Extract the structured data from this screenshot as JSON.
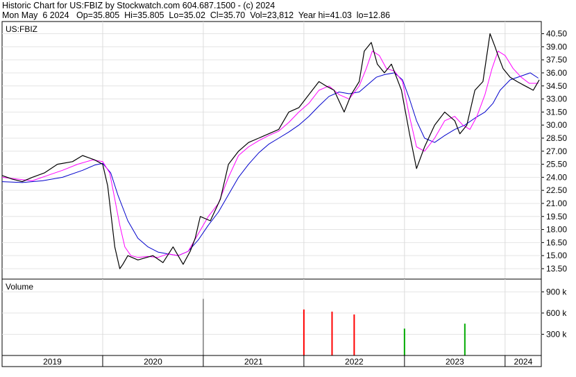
{
  "header": {
    "title": "Historic Chart for US:FBIZ by Stockwatch.com 604.687.1500 - (c) 2024",
    "stats": "Mon May  6 2024   Op=35.805  Hi=35.805  Lo=35.02  Cl=35.70  Vol=23,812  Year hi=41.03  lo=12.86"
  },
  "chart_data": {
    "type": "line",
    "symbol_label": "US:FBIZ",
    "volume_label": "Volume",
    "price_axis": {
      "ticks": [
        "40.50",
        "39.00",
        "37.50",
        "36.00",
        "34.50",
        "33.00",
        "31.50",
        "30.00",
        "28.50",
        "27.00",
        "25.50",
        "24.00",
        "22.50",
        "21.00",
        "19.50",
        "18.00",
        "16.50",
        "15.00",
        "13.50"
      ],
      "ylim": [
        12.3,
        41.9
      ]
    },
    "volume_axis": {
      "ticks": [
        "900 k",
        "600 k",
        "300 k"
      ],
      "ylim": [
        0,
        1080000
      ]
    },
    "years": [
      "2019",
      "2020",
      "2021",
      "2022",
      "2023",
      "2024"
    ],
    "x_range": [
      2019.0,
      2024.36
    ],
    "year_boundaries": [
      2019.0,
      2020.0,
      2021.0,
      2022.0,
      2023.0,
      2024.0
    ],
    "price_series": {
      "name": "",
      "color": "#000000",
      "x": [
        2019.0,
        2019.1,
        2019.2,
        2019.3,
        2019.42,
        2019.55,
        2019.7,
        2019.8,
        2019.92,
        2020.0,
        2020.05,
        2020.12,
        2020.17,
        2020.2,
        2020.25,
        2020.35,
        2020.5,
        2020.6,
        2020.7,
        2020.8,
        2020.87,
        2020.92,
        2020.97,
        2021.07,
        2021.17,
        2021.25,
        2021.35,
        2021.45,
        2021.55,
        2021.65,
        2021.75,
        2021.85,
        2021.95,
        2022.05,
        2022.15,
        2022.22,
        2022.3,
        2022.4,
        2022.47,
        2022.55,
        2022.6,
        2022.67,
        2022.73,
        2022.8,
        2022.87,
        2022.92,
        2022.97,
        2023.05,
        2023.12,
        2023.2,
        2023.3,
        2023.4,
        2023.5,
        2023.55,
        2023.62,
        2023.7,
        2023.78,
        2023.85,
        2023.9,
        2023.93,
        2023.98,
        2024.05,
        2024.12,
        2024.2,
        2024.28,
        2024.34
      ],
      "y": [
        24.2,
        23.8,
        23.5,
        24.0,
        24.5,
        25.5,
        25.8,
        26.5,
        26.0,
        25.5,
        23.0,
        16.0,
        13.5,
        14.0,
        15.0,
        14.5,
        15.0,
        14.2,
        16.0,
        14.0,
        15.5,
        17.0,
        19.5,
        19.0,
        21.5,
        25.5,
        27.0,
        28.0,
        28.5,
        29.0,
        29.5,
        31.5,
        32.0,
        33.5,
        35.0,
        34.5,
        34.0,
        31.5,
        33.5,
        35.0,
        38.5,
        39.5,
        37.0,
        36.0,
        37.0,
        35.5,
        34.0,
        29.0,
        25.0,
        27.5,
        30.0,
        31.5,
        30.5,
        29.0,
        30.0,
        34.0,
        35.0,
        40.5,
        39.0,
        38.0,
        36.5,
        35.5,
        35.0,
        34.5,
        34.0,
        35.2
      ]
    },
    "ma_short": {
      "name": "",
      "color": "#ff00ff",
      "x": [
        2019.0,
        2019.15,
        2019.3,
        2019.45,
        2019.6,
        2019.75,
        2019.9,
        2020.0,
        2020.07,
        2020.12,
        2020.17,
        2020.22,
        2020.28,
        2020.35,
        2020.45,
        2020.55,
        2020.65,
        2020.75,
        2020.85,
        2020.95,
        2021.05,
        2021.15,
        2021.25,
        2021.35,
        2021.45,
        2021.55,
        2021.65,
        2021.75,
        2021.85,
        2021.95,
        2022.05,
        2022.15,
        2022.25,
        2022.35,
        2022.45,
        2022.55,
        2022.62,
        2022.68,
        2022.75,
        2022.82,
        2022.9,
        2022.98,
        2023.05,
        2023.12,
        2023.2,
        2023.3,
        2023.4,
        2023.5,
        2023.58,
        2023.65,
        2023.72,
        2023.8,
        2023.87,
        2023.93,
        2024.0,
        2024.08,
        2024.16,
        2024.24,
        2024.33
      ],
      "y": [
        24.0,
        23.8,
        23.6,
        24.2,
        24.8,
        25.5,
        26.0,
        25.8,
        24.5,
        21.5,
        18.5,
        16.0,
        15.0,
        14.8,
        14.9,
        14.8,
        15.2,
        15.0,
        15.5,
        17.5,
        19.5,
        21.0,
        24.0,
        26.5,
        27.5,
        28.2,
        28.8,
        29.3,
        30.3,
        31.5,
        32.5,
        34.0,
        34.5,
        33.5,
        33.0,
        34.5,
        36.5,
        38.5,
        38.0,
        36.5,
        36.2,
        35.0,
        31.0,
        27.5,
        27.0,
        28.5,
        30.5,
        31.0,
        30.0,
        29.5,
        31.0,
        33.5,
        36.5,
        38.5,
        38.0,
        36.5,
        35.5,
        34.8,
        34.8
      ]
    },
    "ma_long": {
      "name": "",
      "color": "#0000cc",
      "x": [
        2019.0,
        2019.2,
        2019.4,
        2019.6,
        2019.8,
        2019.92,
        2020.0,
        2020.08,
        2020.15,
        2020.25,
        2020.35,
        2020.45,
        2020.55,
        2020.65,
        2020.75,
        2020.85,
        2020.95,
        2021.05,
        2021.15,
        2021.25,
        2021.35,
        2021.45,
        2021.55,
        2021.65,
        2021.75,
        2021.85,
        2021.95,
        2022.05,
        2022.15,
        2022.25,
        2022.35,
        2022.45,
        2022.55,
        2022.65,
        2022.72,
        2022.8,
        2022.9,
        2022.98,
        2023.05,
        2023.12,
        2023.2,
        2023.3,
        2023.4,
        2023.5,
        2023.6,
        2023.7,
        2023.8,
        2023.88,
        2023.95,
        2024.05,
        2024.15,
        2024.25,
        2024.33
      ],
      "y": [
        23.5,
        23.4,
        23.6,
        24.0,
        24.8,
        25.4,
        25.6,
        24.5,
        22.0,
        19.0,
        17.0,
        16.0,
        15.4,
        15.2,
        15.0,
        15.5,
        16.8,
        18.5,
        20.0,
        22.0,
        24.0,
        25.5,
        26.8,
        27.8,
        28.5,
        29.2,
        30.0,
        31.0,
        32.2,
        33.3,
        33.8,
        33.6,
        33.8,
        34.8,
        35.5,
        35.8,
        36.0,
        35.2,
        33.0,
        30.5,
        28.5,
        28.0,
        28.8,
        29.5,
        30.0,
        30.8,
        31.5,
        32.5,
        34.0,
        35.2,
        35.6,
        36.0,
        35.4
      ]
    },
    "volume_spikes": [
      {
        "x": 2021.0,
        "value": 800000,
        "color": "#999999"
      },
      {
        "x": 2022.0,
        "value": 650000,
        "color": "#ff0000"
      },
      {
        "x": 2022.28,
        "value": 620000,
        "color": "#ff0000"
      },
      {
        "x": 2023.0,
        "value": 380000,
        "color": "#00aa00"
      },
      {
        "x": 2023.6,
        "value": 450000,
        "color": "#00aa00"
      },
      {
        "x": 2022.5,
        "value": 580000,
        "color": "#ff0000"
      }
    ],
    "grid": true
  }
}
